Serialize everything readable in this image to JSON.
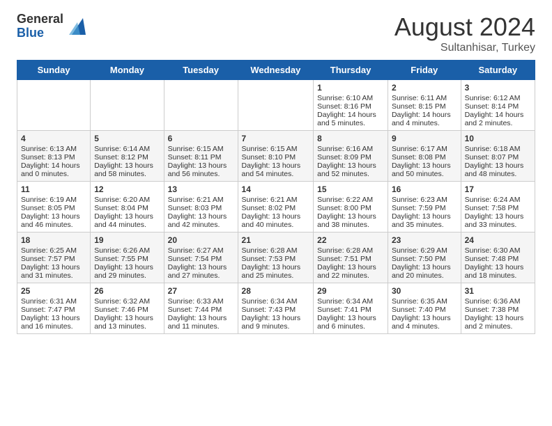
{
  "header": {
    "logo_general": "General",
    "logo_blue": "Blue",
    "month_year": "August 2024",
    "location": "Sultanhisar, Turkey"
  },
  "weekdays": [
    "Sunday",
    "Monday",
    "Tuesday",
    "Wednesday",
    "Thursday",
    "Friday",
    "Saturday"
  ],
  "weeks": [
    [
      {
        "day": "",
        "content": ""
      },
      {
        "day": "",
        "content": ""
      },
      {
        "day": "",
        "content": ""
      },
      {
        "day": "",
        "content": ""
      },
      {
        "day": "1",
        "content": "Sunrise: 6:10 AM\nSunset: 8:16 PM\nDaylight: 14 hours\nand 5 minutes."
      },
      {
        "day": "2",
        "content": "Sunrise: 6:11 AM\nSunset: 8:15 PM\nDaylight: 14 hours\nand 4 minutes."
      },
      {
        "day": "3",
        "content": "Sunrise: 6:12 AM\nSunset: 8:14 PM\nDaylight: 14 hours\nand 2 minutes."
      }
    ],
    [
      {
        "day": "4",
        "content": "Sunrise: 6:13 AM\nSunset: 8:13 PM\nDaylight: 14 hours\nand 0 minutes."
      },
      {
        "day": "5",
        "content": "Sunrise: 6:14 AM\nSunset: 8:12 PM\nDaylight: 13 hours\nand 58 minutes."
      },
      {
        "day": "6",
        "content": "Sunrise: 6:15 AM\nSunset: 8:11 PM\nDaylight: 13 hours\nand 56 minutes."
      },
      {
        "day": "7",
        "content": "Sunrise: 6:15 AM\nSunset: 8:10 PM\nDaylight: 13 hours\nand 54 minutes."
      },
      {
        "day": "8",
        "content": "Sunrise: 6:16 AM\nSunset: 8:09 PM\nDaylight: 13 hours\nand 52 minutes."
      },
      {
        "day": "9",
        "content": "Sunrise: 6:17 AM\nSunset: 8:08 PM\nDaylight: 13 hours\nand 50 minutes."
      },
      {
        "day": "10",
        "content": "Sunrise: 6:18 AM\nSunset: 8:07 PM\nDaylight: 13 hours\nand 48 minutes."
      }
    ],
    [
      {
        "day": "11",
        "content": "Sunrise: 6:19 AM\nSunset: 8:05 PM\nDaylight: 13 hours\nand 46 minutes."
      },
      {
        "day": "12",
        "content": "Sunrise: 6:20 AM\nSunset: 8:04 PM\nDaylight: 13 hours\nand 44 minutes."
      },
      {
        "day": "13",
        "content": "Sunrise: 6:21 AM\nSunset: 8:03 PM\nDaylight: 13 hours\nand 42 minutes."
      },
      {
        "day": "14",
        "content": "Sunrise: 6:21 AM\nSunset: 8:02 PM\nDaylight: 13 hours\nand 40 minutes."
      },
      {
        "day": "15",
        "content": "Sunrise: 6:22 AM\nSunset: 8:00 PM\nDaylight: 13 hours\nand 38 minutes."
      },
      {
        "day": "16",
        "content": "Sunrise: 6:23 AM\nSunset: 7:59 PM\nDaylight: 13 hours\nand 35 minutes."
      },
      {
        "day": "17",
        "content": "Sunrise: 6:24 AM\nSunset: 7:58 PM\nDaylight: 13 hours\nand 33 minutes."
      }
    ],
    [
      {
        "day": "18",
        "content": "Sunrise: 6:25 AM\nSunset: 7:57 PM\nDaylight: 13 hours\nand 31 minutes."
      },
      {
        "day": "19",
        "content": "Sunrise: 6:26 AM\nSunset: 7:55 PM\nDaylight: 13 hours\nand 29 minutes."
      },
      {
        "day": "20",
        "content": "Sunrise: 6:27 AM\nSunset: 7:54 PM\nDaylight: 13 hours\nand 27 minutes."
      },
      {
        "day": "21",
        "content": "Sunrise: 6:28 AM\nSunset: 7:53 PM\nDaylight: 13 hours\nand 25 minutes."
      },
      {
        "day": "22",
        "content": "Sunrise: 6:28 AM\nSunset: 7:51 PM\nDaylight: 13 hours\nand 22 minutes."
      },
      {
        "day": "23",
        "content": "Sunrise: 6:29 AM\nSunset: 7:50 PM\nDaylight: 13 hours\nand 20 minutes."
      },
      {
        "day": "24",
        "content": "Sunrise: 6:30 AM\nSunset: 7:48 PM\nDaylight: 13 hours\nand 18 minutes."
      }
    ],
    [
      {
        "day": "25",
        "content": "Sunrise: 6:31 AM\nSunset: 7:47 PM\nDaylight: 13 hours\nand 16 minutes."
      },
      {
        "day": "26",
        "content": "Sunrise: 6:32 AM\nSunset: 7:46 PM\nDaylight: 13 hours\nand 13 minutes."
      },
      {
        "day": "27",
        "content": "Sunrise: 6:33 AM\nSunset: 7:44 PM\nDaylight: 13 hours\nand 11 minutes."
      },
      {
        "day": "28",
        "content": "Sunrise: 6:34 AM\nSunset: 7:43 PM\nDaylight: 13 hours\nand 9 minutes."
      },
      {
        "day": "29",
        "content": "Sunrise: 6:34 AM\nSunset: 7:41 PM\nDaylight: 13 hours\nand 6 minutes."
      },
      {
        "day": "30",
        "content": "Sunrise: 6:35 AM\nSunset: 7:40 PM\nDaylight: 13 hours\nand 4 minutes."
      },
      {
        "day": "31",
        "content": "Sunrise: 6:36 AM\nSunset: 7:38 PM\nDaylight: 13 hours\nand 2 minutes."
      }
    ]
  ]
}
